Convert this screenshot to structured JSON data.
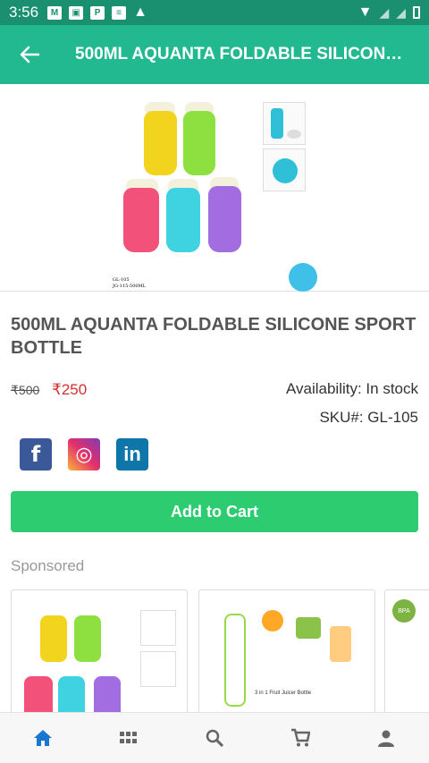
{
  "status_bar": {
    "time": "3:56"
  },
  "appbar": {
    "title": "500ML AQUANTA FOLDABLE SILICONE S..."
  },
  "product": {
    "name": "500ML AQUANTA FOLDABLE SILICONE SPORT BOTTLE",
    "old_price": "₹500",
    "price": "₹250",
    "availability": "Availability: In stock",
    "sku": "SKU#: GL-105",
    "image_code_1": "GL-105",
    "image_code_2": "JG-115-500ML"
  },
  "social": [
    {
      "name": "facebook",
      "label": "f",
      "color": "#3b5998"
    },
    {
      "name": "instagram",
      "label": "◎",
      "color": "#d6249f"
    },
    {
      "name": "linkedin",
      "label": "in",
      "color": "#0e76a8"
    }
  ],
  "add_to_cart_label": "Add to Cart",
  "sponsored_label": "Sponsored",
  "sponsored_cards": [
    {
      "caption": ""
    },
    {
      "caption": "3 in 1 Fruit Juicer Bottle"
    },
    {
      "badge": "BPA"
    }
  ],
  "bottom_nav": [
    "home-icon",
    "grid-icon",
    "search-icon",
    "cart-icon",
    "user-icon"
  ],
  "colors": {
    "primary": "#22b890",
    "status": "#1a9070",
    "cta": "#2ecc71",
    "price": "#d32f2f"
  }
}
